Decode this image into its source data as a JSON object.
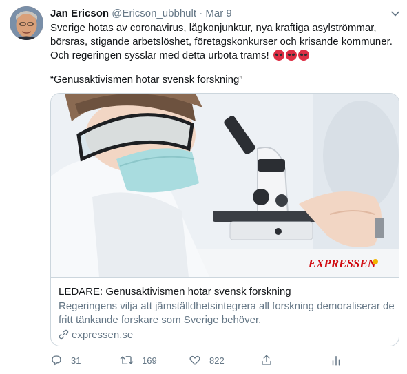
{
  "tweet": {
    "author_name": "Jan Ericson",
    "handle": "@Ericson_ubbhult",
    "separator": "·",
    "date": "Mar 9",
    "text_lines": [
      "Sverige hotas av coronavirus, lågkonjunktur, nya kraftiga asylströmmar,",
      "börsras, stigande arbetslöshet, företagskonkurser  och krisande kommuner.",
      "Och regeringen sysslar med detta urbota trams!"
    ],
    "emoji_names": [
      "angry-face-icon",
      "angry-face-icon",
      "angry-face-icon"
    ],
    "quote": "“Genusaktivismen hotar svensk forskning”"
  },
  "card": {
    "image_logo": "EXPRESSEN",
    "title": "LEDARE: Genusaktivismen hotar svensk forskning",
    "description_lines": [
      "Regeringens vilja att jämställdhetsintegrera all forskning demoraliserar de",
      "fritt tänkande forskare som Sverige behöver."
    ],
    "link": "expressen.se"
  },
  "actions": {
    "reply_count": "31",
    "retweet_count": "169",
    "like_count": "822",
    "icons": [
      "reply-icon",
      "retweet-icon",
      "like-icon",
      "share-icon",
      "analytics-icon"
    ]
  },
  "colors": {
    "text": "#14171a",
    "muted": "#657786",
    "border": "#ccd6dd",
    "emoji": "#dd2e44",
    "logo": "#d10a10"
  }
}
